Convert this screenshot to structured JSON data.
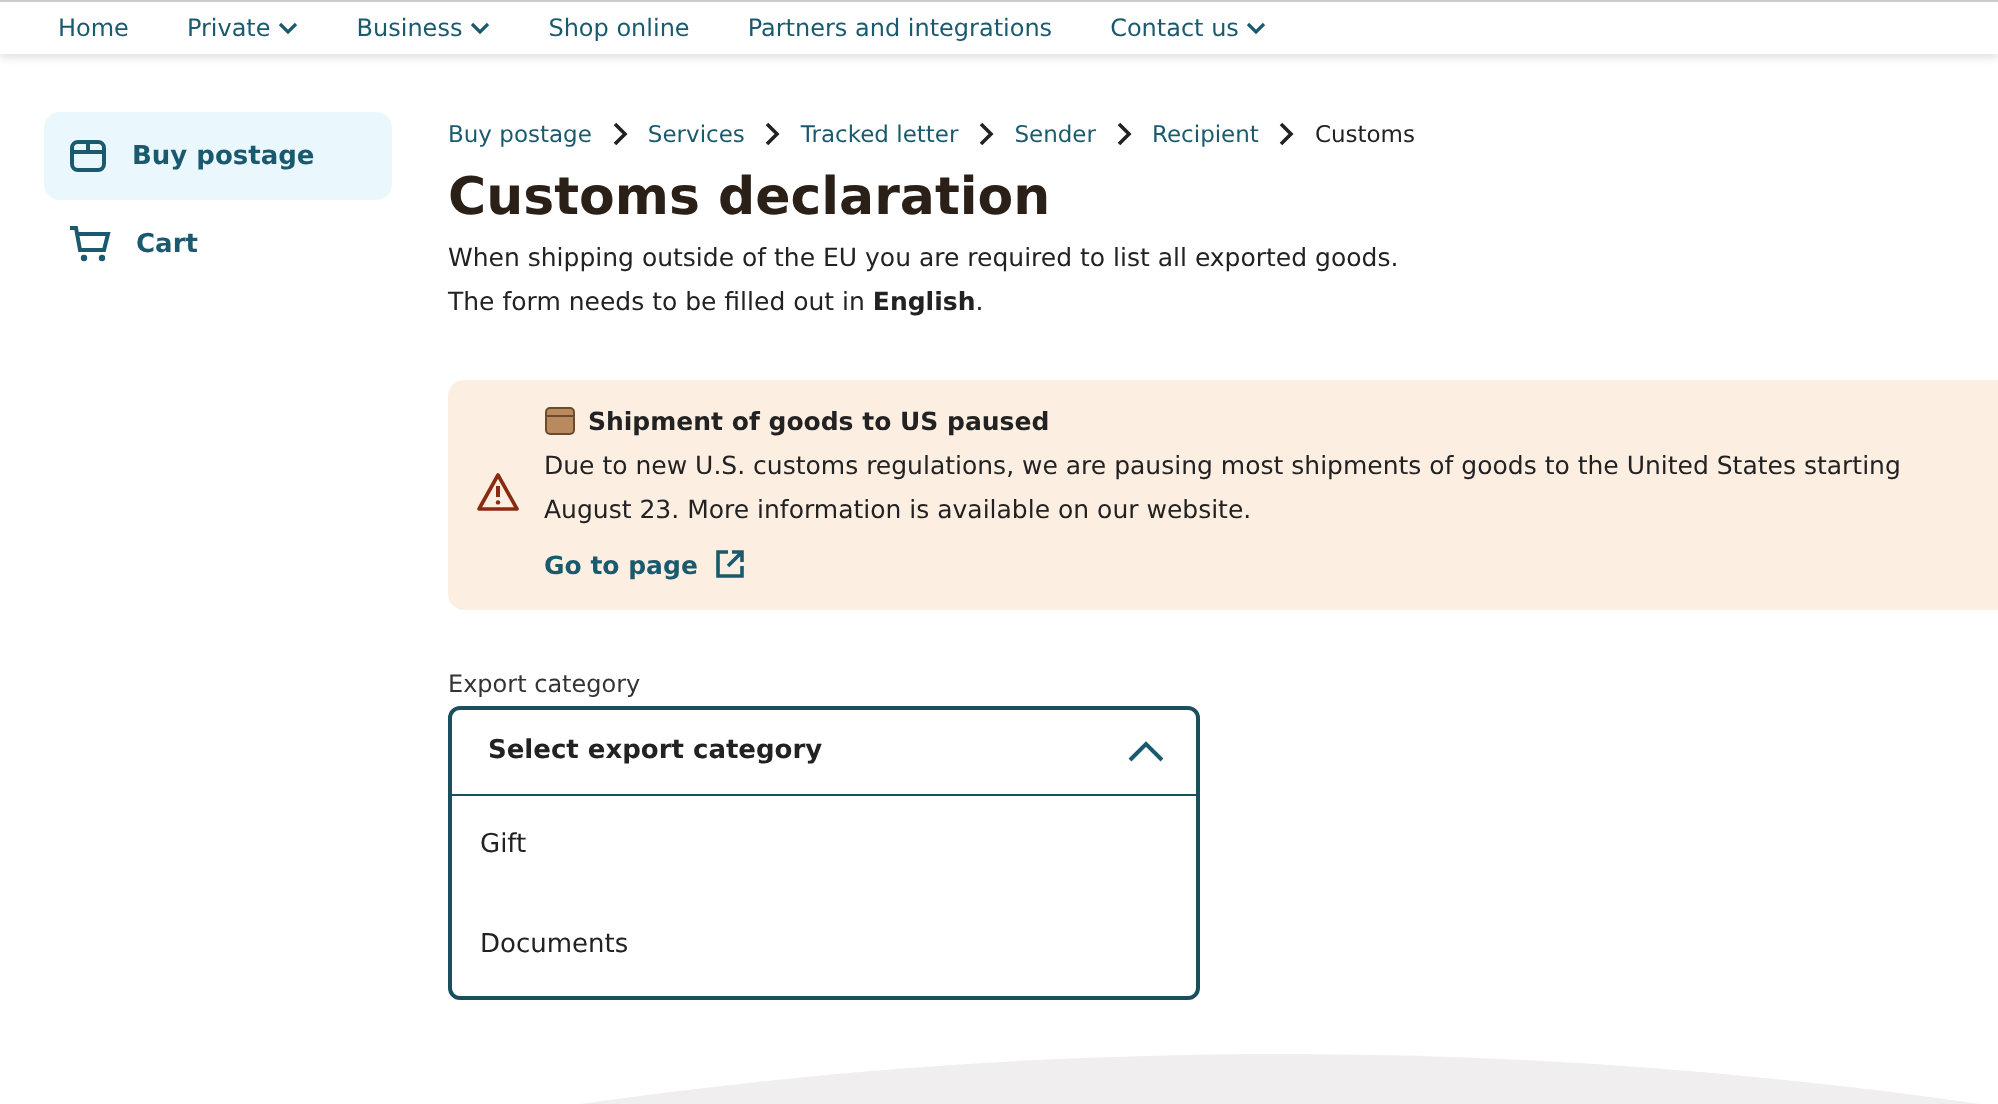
{
  "nav": [
    {
      "label": "Home",
      "has_menu": false
    },
    {
      "label": "Private",
      "has_menu": true
    },
    {
      "label": "Business",
      "has_menu": true
    },
    {
      "label": "Shop online",
      "has_menu": false
    },
    {
      "label": "Partners and integrations",
      "has_menu": false
    },
    {
      "label": "Contact us",
      "has_menu": true
    }
  ],
  "sidebar": {
    "items": [
      {
        "label": "Buy postage",
        "kind": "box",
        "selected": true
      },
      {
        "label": "Cart",
        "kind": "cart",
        "selected": false
      }
    ]
  },
  "breadcrumb": [
    "Buy postage",
    "Services",
    "Tracked letter",
    "Sender",
    "Recipient",
    "Customs"
  ],
  "title": "Customs declaration",
  "intro": [
    "When shipping outside of the EU you are required to list all exported goods.",
    "The form needs to be filled out in **English**."
  ],
  "notice": {
    "title": "Shipment of goods to US paused",
    "text": "Due to new U.S. customs regulations, we are pausing most shipments of goods to the United States starting August 23. More information is available on our website.",
    "link": "Go to page"
  },
  "export_category": {
    "label": "Export category",
    "placeholder": "Select export category",
    "expanded": true,
    "options": [
      "Gift",
      "Documents"
    ]
  }
}
